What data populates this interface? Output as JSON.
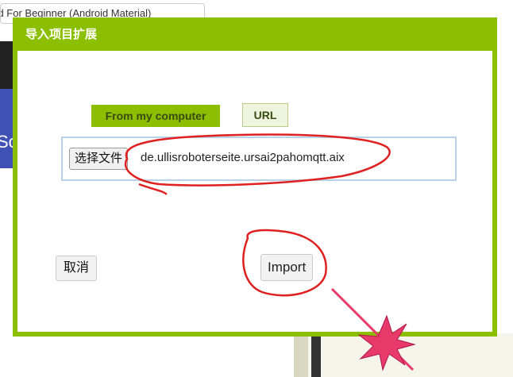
{
  "background": {
    "tab_text": "roid For Beginner (Android Material)",
    "side_text": "Sc"
  },
  "dialog": {
    "title": "导入项目扩展",
    "tabs": {
      "computer": "From my computer",
      "url": "URL"
    },
    "file": {
      "button_label": "选择文件",
      "filename": "de.ullisroboterseite.ursai2pahomqtt.aix"
    },
    "cancel_label": "取消",
    "import_label": "Import"
  },
  "colors": {
    "dialog_green": "#8cbf00",
    "annotation_red": "#e02020",
    "star_pink": "#e83a6a"
  }
}
